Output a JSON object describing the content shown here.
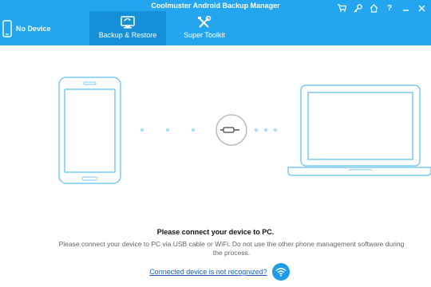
{
  "app": {
    "title": "Coolmuster Android Backup Manager"
  },
  "device": {
    "label": "No Device",
    "icon": "phone-icon"
  },
  "tabs": [
    {
      "label": "Backup & Restore",
      "icon": "backup-restore-icon",
      "active": true
    },
    {
      "label": "Super Toolkit",
      "icon": "tools-icon",
      "active": false
    }
  ],
  "window_controls": [
    "cart-icon",
    "key-icon",
    "home-icon",
    "help-icon",
    "minimize-icon",
    "close-icon"
  ],
  "message": {
    "title": "Please connect your device to PC.",
    "body": "Please connect your device to PC via USB cable or WiFi. Do not use the other phone management software during the process."
  },
  "help": {
    "link_text": "Connected device is not recognized?",
    "icon": "wifi-icon"
  },
  "colors": {
    "header": "#23a6ef",
    "active_tab": "#1590d8",
    "illustration": "#7cc8f2"
  }
}
